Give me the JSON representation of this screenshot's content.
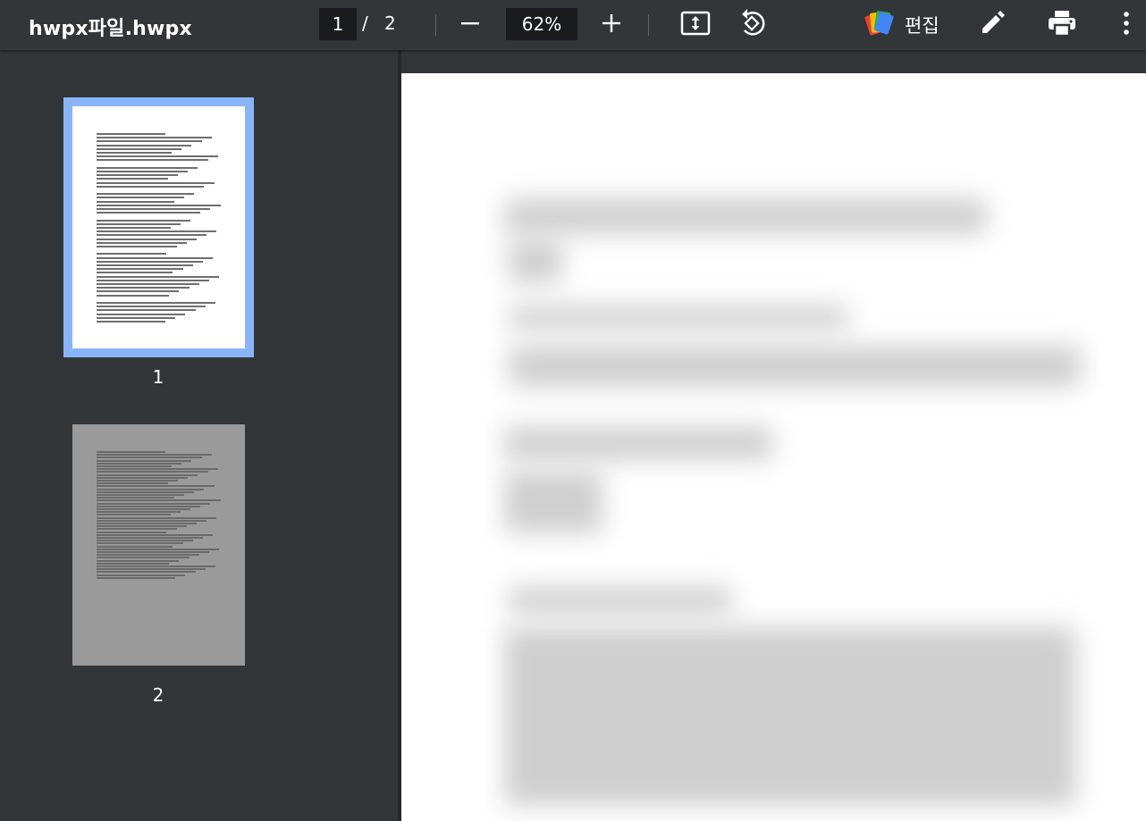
{
  "toolbar": {
    "file_title": "hwpx파일.hwpx",
    "current_page": "1",
    "page_separator": "/",
    "total_pages": "2",
    "zoom": "62%",
    "edit_label": "편집",
    "icons": {
      "zoom_out": "minus-icon",
      "zoom_in": "plus-icon",
      "fit": "fit-to-page-icon",
      "rotate": "rotate-icon",
      "edit_logo": "docs-edit-icon",
      "annotate": "pencil-icon",
      "print": "printer-icon",
      "more": "more-vert-icon"
    }
  },
  "sidebar": {
    "thumbnails": [
      {
        "label": "1",
        "selected": true
      },
      {
        "label": "2",
        "selected": false
      }
    ]
  },
  "colors": {
    "toolbar_bg": "#323639",
    "selected_border": "#8ab4f8",
    "page_bg": "#ffffff"
  }
}
